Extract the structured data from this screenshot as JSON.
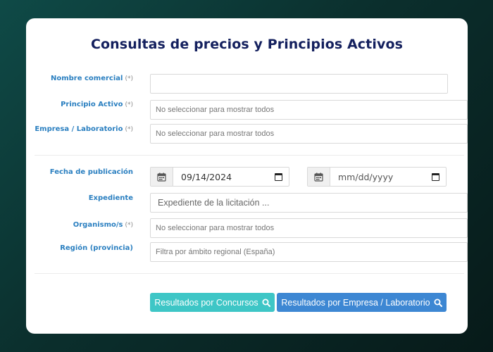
{
  "title": "Consultas de precios y Principios Activos",
  "required_mark": "(*)",
  "fields": {
    "nombre_comercial": {
      "label": "Nombre comercial",
      "value": ""
    },
    "principio_activo": {
      "label": "Principio Activo",
      "placeholder": "No seleccionar para mostrar todos"
    },
    "empresa": {
      "label": "Empresa / Laboratorio",
      "placeholder": "No seleccionar para mostrar todos"
    },
    "fecha": {
      "label": "Fecha de publicación",
      "from_value": "09/14/2024",
      "to_placeholder": "mm/dd/yyyy"
    },
    "expediente": {
      "label": "Expediente",
      "placeholder": "Expediente de la licitación ..."
    },
    "organismo": {
      "label": "Organismo/s",
      "placeholder": "No seleccionar para mostrar todos"
    },
    "region": {
      "label": "Región (provincia)",
      "placeholder": "Filtra por ámbito regional (España)"
    }
  },
  "buttons": {
    "concursos": {
      "label": "Resultados por Concursos",
      "icon": "search-icon",
      "color": "#3ec6c6"
    },
    "empresa": {
      "label": "Resultados por Empresa / Laboratorio",
      "icon": "search-icon",
      "color": "#3d87d3"
    }
  },
  "colors": {
    "title": "#14205e",
    "label": "#2a7fc0",
    "background": "#0b2f2d"
  }
}
